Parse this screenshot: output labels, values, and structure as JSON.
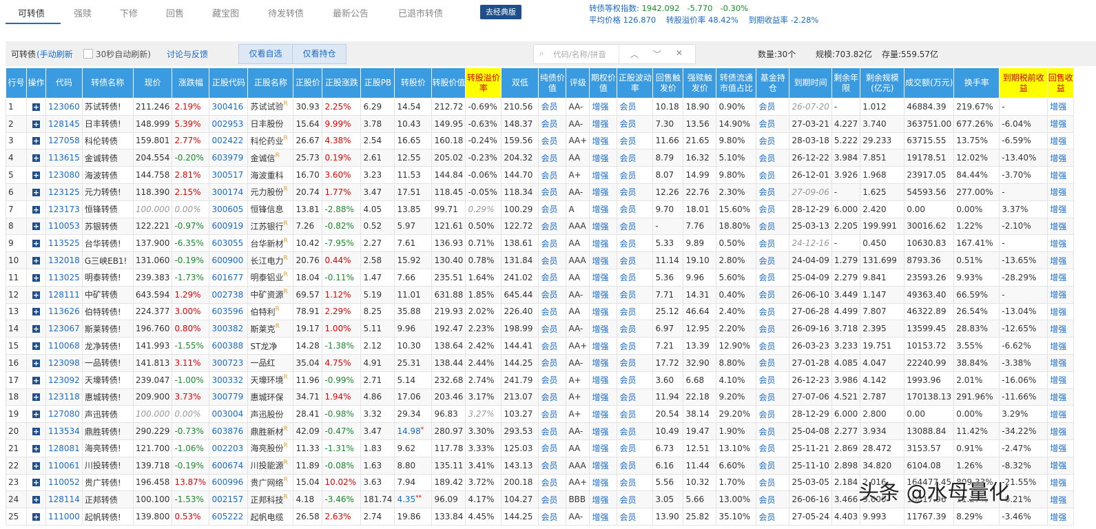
{
  "tabs": [
    "可转债",
    "强赎",
    "下修",
    "回售",
    "藏宝图",
    "待发转债",
    "最新公告",
    "已退市转债"
  ],
  "classic_button": "去经典版",
  "index_stats": {
    "label": "转债等权指数:",
    "value": "1942.092",
    "change": "-5.770",
    "change_pct": "-0.30%",
    "avg_price": "平均价格 126.870",
    "avg_premium": "转股溢价率 48.42%",
    "ytm": "到期收益率 -2.28%"
  },
  "toolbar": {
    "title": "可转债",
    "mode": "(手动刷新",
    "auto_refresh": "30秒自动刷新)",
    "feedback": "讨论与反馈",
    "only_watch": "仅看自选",
    "only_holding": "仅看持仓",
    "search_placeholder": "代码/名称/拼音",
    "count": "数量:30个",
    "scale": "规模:703.82亿",
    "stock": "存量:559.57亿"
  },
  "columns": [
    "行号",
    "操作",
    "代码",
    "转债名称",
    "现价",
    "涨跌幅",
    "正股代码",
    "正股名称",
    "正股价",
    "正股涨跌",
    "正股PB",
    "转股价",
    "转股价值",
    "转股溢价率",
    "双低",
    "纯债价值",
    "评级",
    "期权价值",
    "正股波动率",
    "回售触发价",
    "强赎触发价",
    "转债流通市值占比",
    "基金持仓",
    "到期时间",
    "剩余年限",
    "剩余规模(亿元)",
    "成交额(万元)",
    "换手率",
    "到期税前收益",
    "回售收益"
  ],
  "colors": {
    "header_bg": "#3b9be1",
    "highlight_bg": "#ffff00",
    "up": "#e60000",
    "down": "#1a8a2a",
    "link": "#1a6bc4"
  },
  "rows": [
    [
      "1",
      "123060",
      "苏试转债!",
      "211.246",
      "2.19%",
      "300416",
      "苏试试验",
      "R",
      "30.93",
      "2.25%",
      "6.29",
      "14.54",
      "",
      "212.72",
      "-0.69%",
      "210.56",
      "会员",
      "AA-",
      "增强",
      "会员",
      "10.18",
      "18.90",
      "0.90%",
      "会员",
      "26-07-20",
      "-",
      "1.012",
      "46884.39",
      "219.67%",
      "-",
      "增强"
    ],
    [
      "2",
      "128145",
      "日丰转债!",
      "148.999",
      "5.39%",
      "002953",
      "日丰股份",
      "",
      "15.64",
      "9.99%",
      "3.78",
      "10.43",
      "",
      "149.95",
      "-0.63%",
      "148.37",
      "会员",
      "AA-",
      "增强",
      "会员",
      "7.30",
      "13.56",
      "14.90%",
      "会员",
      "27-03-21",
      "4.227",
      "3.740",
      "363751.00",
      "677.26%",
      "-6.04%",
      "增强"
    ],
    [
      "3",
      "127058",
      "科伦转债",
      "159.801",
      "2.77%",
      "002422",
      "科伦药业",
      "R",
      "26.67",
      "4.38%",
      "2.54",
      "16.65",
      "",
      "160.18",
      "-0.24%",
      "159.56",
      "会员",
      "AA+",
      "增强",
      "会员",
      "11.66",
      "21.65",
      "9.80%",
      "会员",
      "28-03-18",
      "5.222",
      "29.233",
      "63715.55",
      "13.75%",
      "-6.59%",
      "增强"
    ],
    [
      "4",
      "113615",
      "金诚转债",
      "204.554",
      "-0.20%",
      "603979",
      "金诚信",
      "R",
      "25.73",
      "0.19%",
      "2.61",
      "12.55",
      "",
      "205.02",
      "-0.23%",
      "204.32",
      "会员",
      "AA",
      "增强",
      "会员",
      "8.79",
      "16.32",
      "5.10%",
      "会员",
      "26-12-22",
      "3.984",
      "7.851",
      "19178.51",
      "12.02%",
      "-13.40%",
      "增强"
    ],
    [
      "5",
      "123080",
      "海波转债",
      "144.758",
      "2.81%",
      "300517",
      "海波重科",
      "",
      "16.70",
      "3.60%",
      "3.23",
      "11.53",
      "",
      "144.84",
      "-0.06%",
      "144.70",
      "会员",
      "A+",
      "增强",
      "会员",
      "8.07",
      "14.99",
      "9.80%",
      "会员",
      "26-12-01",
      "3.926",
      "1.968",
      "23917.05",
      "84.44%",
      "-3.70%",
      "增强"
    ],
    [
      "6",
      "123125",
      "元力转债!",
      "118.390",
      "2.15%",
      "300174",
      "元力股份",
      "R",
      "20.74",
      "1.77%",
      "3.47",
      "17.51",
      "",
      "118.45",
      "-0.05%",
      "118.34",
      "会员",
      "AA-",
      "增强",
      "会员",
      "12.26",
      "22.76",
      "2.30%",
      "会员",
      "27-09-06",
      "-",
      "1.625",
      "54593.56",
      "277.00%",
      "-",
      "增强"
    ],
    [
      "7",
      "123173",
      "恒锋转债",
      "100.000",
      "0.00%",
      "300605",
      "恒锋信息",
      "",
      "13.81",
      "-2.88%",
      "4.05",
      "13.85",
      "",
      "99.71",
      "0.29%",
      "100.29",
      "会员",
      "A",
      "增强",
      "会员",
      "9.70",
      "18.01",
      "15.60%",
      "会员",
      "28-12-29",
      "6.000",
      "2.420",
      "0.00",
      "0.00%",
      "3.37%",
      "增强"
    ],
    [
      "8",
      "110053",
      "苏银转债",
      "122.221",
      "-0.97%",
      "600919",
      "江苏银行",
      "R",
      "7.26",
      "-0.82%",
      "0.52",
      "5.97",
      "",
      "121.61",
      "0.50%",
      "122.72",
      "会员",
      "AAA",
      "增强",
      "会员",
      "-",
      "7.76",
      "18.80%",
      "会员",
      "25-03-13",
      "2.205",
      "199.991",
      "30016.62",
      "1.22%",
      "-2.10%",
      "增强"
    ],
    [
      "9",
      "113525",
      "台华转债!",
      "137.900",
      "-6.35%",
      "603055",
      "台华新材",
      "R",
      "10.42",
      "-7.95%",
      "2.27",
      "7.61",
      "",
      "136.93",
      "0.71%",
      "138.61",
      "会员",
      "AA",
      "增强",
      "会员",
      "5.33",
      "9.89",
      "0.50%",
      "会员",
      "24-12-16",
      "-",
      "0.450",
      "10630.83",
      "167.41%",
      "-",
      "增强"
    ],
    [
      "10",
      "132018",
      "G三峡EB1!",
      "131.060",
      "-0.19%",
      "600900",
      "长江电力",
      "R",
      "20.76",
      "0.44%",
      "2.58",
      "15.92",
      "",
      "130.40",
      "0.78%",
      "131.84",
      "会员",
      "AAA",
      "增强",
      "会员",
      "11.14",
      "19.10",
      "2.80%",
      "会员",
      "24-04-09",
      "1.279",
      "131.699",
      "8793.36",
      "0.51%",
      "-13.65%",
      "增强"
    ],
    [
      "11",
      "113025",
      "明泰转债!",
      "239.383",
      "-1.73%",
      "601677",
      "明泰铝业",
      "R",
      "18.04",
      "-0.11%",
      "1.47",
      "7.66",
      "",
      "235.51",
      "1.64%",
      "241.02",
      "会员",
      "AA",
      "增强",
      "会员",
      "5.36",
      "9.96",
      "5.60%",
      "会员",
      "25-04-09",
      "2.279",
      "9.841",
      "23593.26",
      "9.93%",
      "-28.29%",
      "增强"
    ],
    [
      "12",
      "128111",
      "中矿转债",
      "643.594",
      "1.29%",
      "002738",
      "中矿资源",
      "R",
      "69.57",
      "1.12%",
      "5.19",
      "11.01",
      "",
      "631.88",
      "1.85%",
      "645.44",
      "会员",
      "AA-",
      "增强",
      "会员",
      "7.71",
      "14.31",
      "0.40%",
      "会员",
      "26-06-10",
      "3.449",
      "1.147",
      "49363.40",
      "66.59%",
      "-",
      "增强"
    ],
    [
      "13",
      "113626",
      "伯特转债!",
      "224.377",
      "3.00%",
      "603596",
      "伯特利",
      "R",
      "78.91",
      "2.29%",
      "8.25",
      "35.88",
      "",
      "219.93",
      "2.02%",
      "226.40",
      "会员",
      "AA",
      "增强",
      "会员",
      "25.12",
      "46.64",
      "2.40%",
      "会员",
      "27-06-28",
      "4.499",
      "7.807",
      "46322.89",
      "26.54%",
      "-13.04%",
      "增强"
    ],
    [
      "14",
      "123067",
      "斯莱转债!",
      "196.760",
      "0.80%",
      "300382",
      "斯莱克",
      "R",
      "19.17",
      "1.00%",
      "5.11",
      "9.96",
      "",
      "192.47",
      "2.23%",
      "198.99",
      "会员",
      "AA-",
      "增强",
      "会员",
      "6.97",
      "12.95",
      "2.20%",
      "会员",
      "26-09-16",
      "3.718",
      "2.395",
      "13599.45",
      "28.83%",
      "-12.65%",
      "增强"
    ],
    [
      "15",
      "110068",
      "龙净转债!",
      "141.993",
      "-1.55%",
      "600388",
      "ST龙净",
      "",
      "14.28",
      "-1.38%",
      "2.12",
      "10.30",
      "",
      "138.64",
      "2.42%",
      "144.41",
      "会员",
      "AA+",
      "增强",
      "会员",
      "7.21",
      "13.39",
      "12.90%",
      "会员",
      "26-03-23",
      "3.233",
      "19.751",
      "10153.72",
      "3.55%",
      "-6.62%",
      "增强"
    ],
    [
      "16",
      "123098",
      "一品转债!",
      "141.813",
      "3.11%",
      "300723",
      "一品红",
      "",
      "35.04",
      "4.75%",
      "4.91",
      "25.31",
      "",
      "138.44",
      "2.44%",
      "144.25",
      "会员",
      "AA-",
      "增强",
      "会员",
      "17.72",
      "32.90",
      "8.80%",
      "会员",
      "27-01-28",
      "4.085",
      "4.047",
      "22240.99",
      "38.84%",
      "-3.38%",
      "增强"
    ],
    [
      "17",
      "123092",
      "天壕转债!",
      "239.047",
      "-1.00%",
      "300332",
      "天壕环境",
      "R",
      "11.96",
      "-0.99%",
      "2.71",
      "5.14",
      "",
      "232.68",
      "2.74%",
      "241.79",
      "会员",
      "A+",
      "增强",
      "会员",
      "3.60",
      "6.68",
      "4.10%",
      "会员",
      "26-12-23",
      "3.986",
      "4.142",
      "1993.96",
      "2.01%",
      "-16.06%",
      "增强"
    ],
    [
      "18",
      "123118",
      "惠城转债!",
      "209.900",
      "3.73%",
      "300779",
      "惠城环保",
      "",
      "34.71",
      "1.94%",
      "4.86",
      "17.06",
      "",
      "203.46",
      "3.17%",
      "213.07",
      "会员",
      "A+",
      "增强",
      "会员",
      "11.94",
      "22.18",
      "9.20%",
      "会员",
      "27-07-06",
      "4.521",
      "2.787",
      "170138.13",
      "291.96%",
      "-11.66%",
      "增强"
    ],
    [
      "19",
      "127080",
      "声迅转债",
      "100.000",
      "0.00%",
      "003004",
      "声迅股份",
      "",
      "28.41",
      "-0.98%",
      "3.32",
      "29.34",
      "",
      "96.83",
      "3.27%",
      "103.27",
      "会员",
      "A+",
      "增强",
      "会员",
      "20.54",
      "38.14",
      "29.20%",
      "会员",
      "28-12-29",
      "6.000",
      "2.800",
      "0.00",
      "0.00%",
      "3.29%",
      "增强"
    ],
    [
      "20",
      "113534",
      "鼎胜转债!",
      "290.229",
      "-0.73%",
      "603876",
      "鼎胜新材",
      "R",
      "42.09",
      "-0.47%",
      "3.47",
      "14.98",
      "*",
      "280.97",
      "3.30%",
      "293.53",
      "会员",
      "AA-",
      "增强",
      "会员",
      "10.49",
      "19.47",
      "1.90%",
      "会员",
      "25-04-08",
      "2.277",
      "3.934",
      "13088.84",
      "11.42%",
      "-34.22%",
      "增强"
    ],
    [
      "21",
      "128081",
      "海亮转债!",
      "121.700",
      "-1.06%",
      "002203",
      "海亮股份",
      "R",
      "11.33",
      "-1.31%",
      "1.83",
      "9.62",
      "",
      "117.78",
      "3.33%",
      "125.03",
      "会员",
      "AA",
      "增强",
      "会员",
      "6.73",
      "12.51",
      "13.10%",
      "会员",
      "25-11-21",
      "2.869",
      "28.472",
      "3153.57",
      "0.91%",
      "-2.47%",
      "增强"
    ],
    [
      "22",
      "110061",
      "川投转债!",
      "139.718",
      "-0.19%",
      "600674",
      "川投能源",
      "R",
      "11.89",
      "-0.08%",
      "1.63",
      "8.80",
      "",
      "135.11",
      "3.41%",
      "143.13",
      "会员",
      "AAA",
      "增强",
      "会员",
      "6.16",
      "11.44",
      "6.60%",
      "会员",
      "25-11-10",
      "2.898",
      "34.820",
      "6104.08",
      "1.26%",
      "-8.32%",
      "增强"
    ],
    [
      "23",
      "110052",
      "贵广转债!",
      "196.458",
      "13.87%",
      "600996",
      "贵广网络",
      "R",
      "15.04",
      "10.02%",
      "3.63",
      "7.94",
      "",
      "189.42",
      "3.72%",
      "200.18",
      "会员",
      "AA+",
      "增强",
      "会员",
      "5.56",
      "10.32",
      "1.70%",
      "会员",
      "25-03-05",
      "2.184",
      "2.016",
      "164477.45",
      "809.33%",
      "-21.55%",
      "增强"
    ],
    [
      "24",
      "128114",
      "正邦转债",
      "100.100",
      "-1.53%",
      "002157",
      "正邦科技",
      "R",
      "4.18",
      "-3.46%",
      "181.74",
      "4.35",
      "**",
      "96.09",
      "4.17%",
      "104.27",
      "会员",
      "BBB",
      "增强",
      "会员",
      "3.05",
      "5.66",
      "13.00%",
      "会员",
      "26-06-16",
      "3.466",
      "9.600",
      "10817.96",
      "11.27%",
      "-0.21%",
      "增强"
    ],
    [
      "25",
      "111000",
      "起帆转债!",
      "139.800",
      "0.53%",
      "605222",
      "起帆电缆",
      "",
      "26.58",
      "2.63%",
      "2.74",
      "19.86",
      "",
      "133.84",
      "4.45%",
      "144.25",
      "会员",
      "AA-",
      "增强",
      "会员",
      "13.90",
      "25.82",
      "35.10%",
      "会员",
      "27-05-24",
      "4.403",
      "9.993",
      "11767.39",
      "8.29%",
      "-3.46%",
      "增强"
    ]
  ],
  "watermark": "头条 @水母量化"
}
